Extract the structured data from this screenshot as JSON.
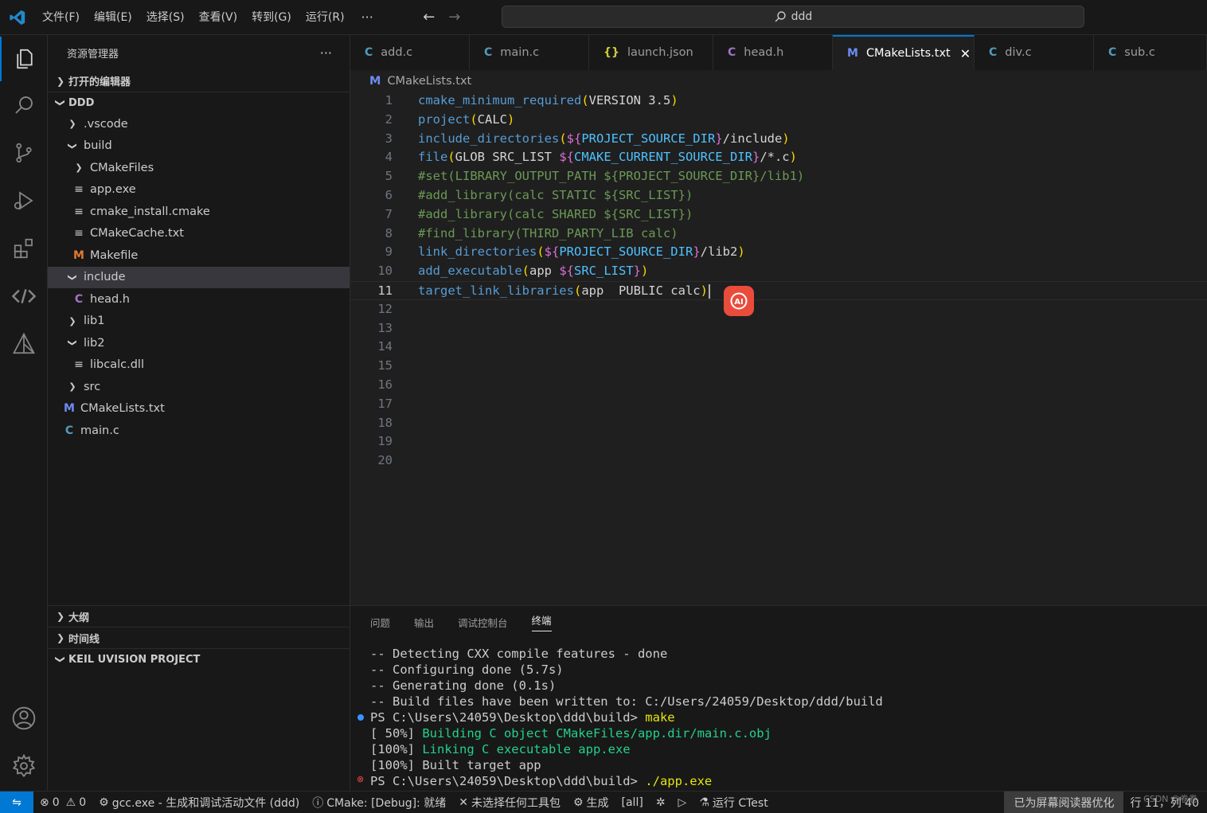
{
  "titlebar": {
    "menus": [
      "文件(F)",
      "编辑(E)",
      "选择(S)",
      "查看(V)",
      "转到(G)",
      "运行(R)"
    ],
    "more": "···",
    "search_text": "ddd"
  },
  "sidebar": {
    "title": "资源管理器",
    "more": "···",
    "open_editors": "打开的编辑器",
    "root": "DDD",
    "tree": [
      {
        "label": ".vscode",
        "icon": "chevron-right",
        "indent": 1
      },
      {
        "label": "build",
        "icon": "chevron-down",
        "indent": 1
      },
      {
        "label": "CMakeFiles",
        "icon": "chevron-right",
        "indent": 2
      },
      {
        "label": "app.exe",
        "icon": "lines",
        "indent": 2
      },
      {
        "label": "cmake_install.cmake",
        "icon": "lines",
        "indent": 2
      },
      {
        "label": "CMakeCache.txt",
        "icon": "lines",
        "indent": 2
      },
      {
        "label": "Makefile",
        "icon": "M",
        "indent": 2
      },
      {
        "label": "include",
        "icon": "chevron-down",
        "indent": 1,
        "selected": true
      },
      {
        "label": "head.h",
        "icon": "C",
        "indent": 2
      },
      {
        "label": "lib1",
        "icon": "chevron-right",
        "indent": 1
      },
      {
        "label": "lib2",
        "icon": "chevron-down",
        "indent": 1
      },
      {
        "label": "libcalc.dll",
        "icon": "lines",
        "indent": 2
      },
      {
        "label": "src",
        "icon": "chevron-right",
        "indent": 1
      },
      {
        "label": "CMakeLists.txt",
        "icon": "M",
        "indent": 1
      },
      {
        "label": "main.c",
        "icon": "C",
        "indent": 1
      }
    ],
    "outline": "大纲",
    "timeline": "时间线",
    "keil": "KEIL UVISION PROJECT"
  },
  "tabs": [
    {
      "label": "add.c",
      "icon": "C"
    },
    {
      "label": "main.c",
      "icon": "C"
    },
    {
      "label": "launch.json",
      "icon": "{}"
    },
    {
      "label": "head.h",
      "icon": "C"
    },
    {
      "label": "CMakeLists.txt",
      "icon": "M",
      "active": true
    },
    {
      "label": "div.c",
      "icon": "C"
    },
    {
      "label": "sub.c",
      "icon": "C"
    }
  ],
  "breadcrumb": "CMakeLists.txt",
  "editor": {
    "line_numbers": [
      "1",
      "2",
      "3",
      "4",
      "5",
      "6",
      "7",
      "8",
      "9",
      "10",
      "11",
      "12",
      "13",
      "14",
      "15",
      "16",
      "17",
      "18",
      "19",
      "20"
    ],
    "current_line": 11,
    "lines": [
      "cmake_minimum_required(VERSION 3.5)",
      "project(CALC)",
      "include_directories(${PROJECT_SOURCE_DIR}/include)",
      "file(GLOB SRC_LIST ${CMAKE_CURRENT_SOURCE_DIR}/*.c)",
      "#set(LIBRARY_OUTPUT_PATH ${PROJECT_SOURCE_DIR}/lib1)",
      "#add_library(calc STATIC ${SRC_LIST})",
      "#add_library(calc SHARED ${SRC_LIST})",
      "#find_library(THIRD_PARTY_LIB calc)",
      "link_directories(${PROJECT_SOURCE_DIR}/lib2)",
      "add_executable(app ${SRC_LIST})",
      "target_link_libraries(app  PUBLIC calc)"
    ],
    "ai_badge": "AI"
  },
  "panel": {
    "tabs": [
      "问题",
      "输出",
      "调试控制台",
      "终端"
    ],
    "active_tab": "终端",
    "terminal": [
      "-- Detecting CXX compile features - done",
      "-- Configuring done (5.7s)",
      "-- Generating done (0.1s)",
      "-- Build files have been written to: C:/Users/24059/Desktop/ddd/build",
      "PS C:\\Users\\24059\\Desktop\\ddd\\build> ",
      "make",
      "[ 50%] ",
      "Building C object CMakeFiles/app.dir/main.c.obj",
      "[100%] ",
      "Linking C executable app.exe",
      "[100%] Built target app",
      "PS C:\\Users\\24059\\Desktop\\ddd\\build> ",
      "./app.exe"
    ]
  },
  "statusbar": {
    "errors": "0",
    "warnings": "0",
    "debug": "gcc.exe - 生成和调试活动文件 (ddd)",
    "cmake": "CMake: [Debug]: 就绪",
    "kit": "未选择任何工具包",
    "build": "生成",
    "target": "[all]",
    "ctest": "运行 CTest",
    "screen_reader": "已为屏幕阅读器优化",
    "position": "行 11，列 40",
    "watermark": "CSDN @卷卷"
  },
  "colors": {
    "accent": "#0078d4",
    "function": "#569cd6",
    "comment": "#6a9955",
    "variable": "#4fc1ff",
    "ai_badge": "#ea4c3c"
  }
}
